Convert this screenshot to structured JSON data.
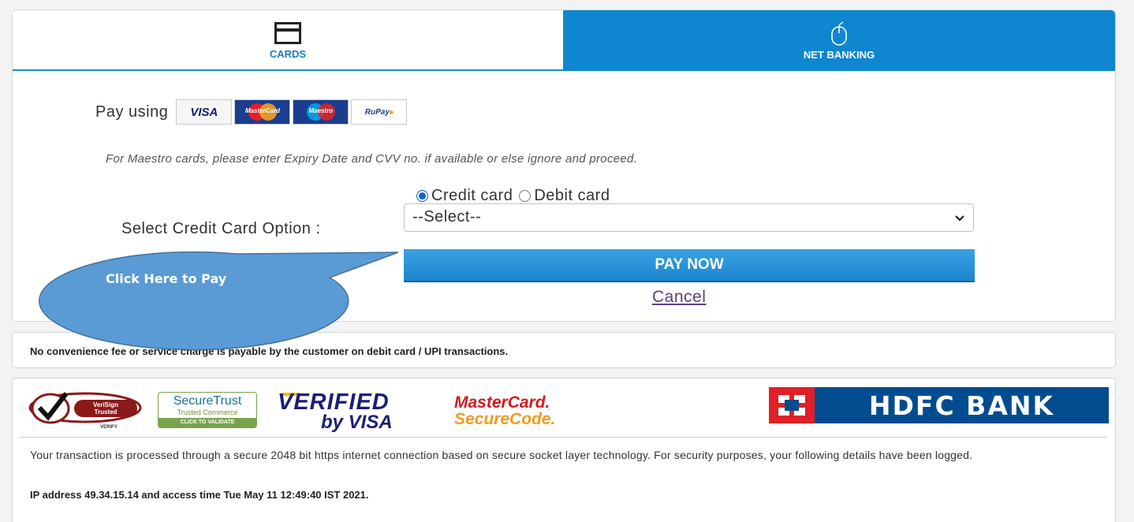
{
  "tabs": [
    {
      "label": "CARDS",
      "icon": "credit-card-icon",
      "active": true
    },
    {
      "label": "NET BANKING",
      "icon": "mouse-icon",
      "active": false
    }
  ],
  "payment": {
    "pay_using_label": "Pay using",
    "card_logos": {
      "visa": "VISA",
      "mastercard": "MasterCard",
      "maestro": "Maestro",
      "rupay": "RuPay"
    },
    "maestro_note": "For Maestro cards, please enter Expiry Date and CVV no. if available or else ignore and proceed.",
    "card_types": [
      {
        "label": "Credit card",
        "checked": true
      },
      {
        "label": "Debit card",
        "checked": false
      }
    ],
    "select_label": "Select Credit Card Option :",
    "select_value": "--Select--",
    "pay_button": "PAY NOW",
    "cancel_link": "Cancel"
  },
  "callout": {
    "text": "Click Here to Pay",
    "color": "#5b9bd5"
  },
  "fee_notice": "No convenience fee or service charge is payable by the customer on debit card / UPI transactions.",
  "trust": {
    "verisign_1": "VeriSign",
    "verisign_2": "Trusted",
    "verisign_3": "VERIFY",
    "securetrust_title": "SecureTrust",
    "securetrust_sub": "Trusted Commerce",
    "securetrust_bar": "CLICK TO VALIDATE",
    "verified_1": "VERIFIED",
    "verified_2": "by VISA",
    "mc_1": "MasterCard.",
    "mc_2": "SecureCode.",
    "hdfc": "HDFC BANK"
  },
  "security_text": "Your transaction is processed through a secure 2048 bit https internet connection based on secure socket layer technology. For security purposes, your following details have been logged.",
  "ip_text": "IP address 49.34.15.14 and access time Tue May 11 12:49:40 IST 2021.",
  "colors": {
    "tab_active_text": "#1a7cc4",
    "tab_inactive_bg": "#0f86d0",
    "pay_button": "#2596d9",
    "hdfc_blue": "#004c8f",
    "hdfc_red": "#e01f26"
  }
}
